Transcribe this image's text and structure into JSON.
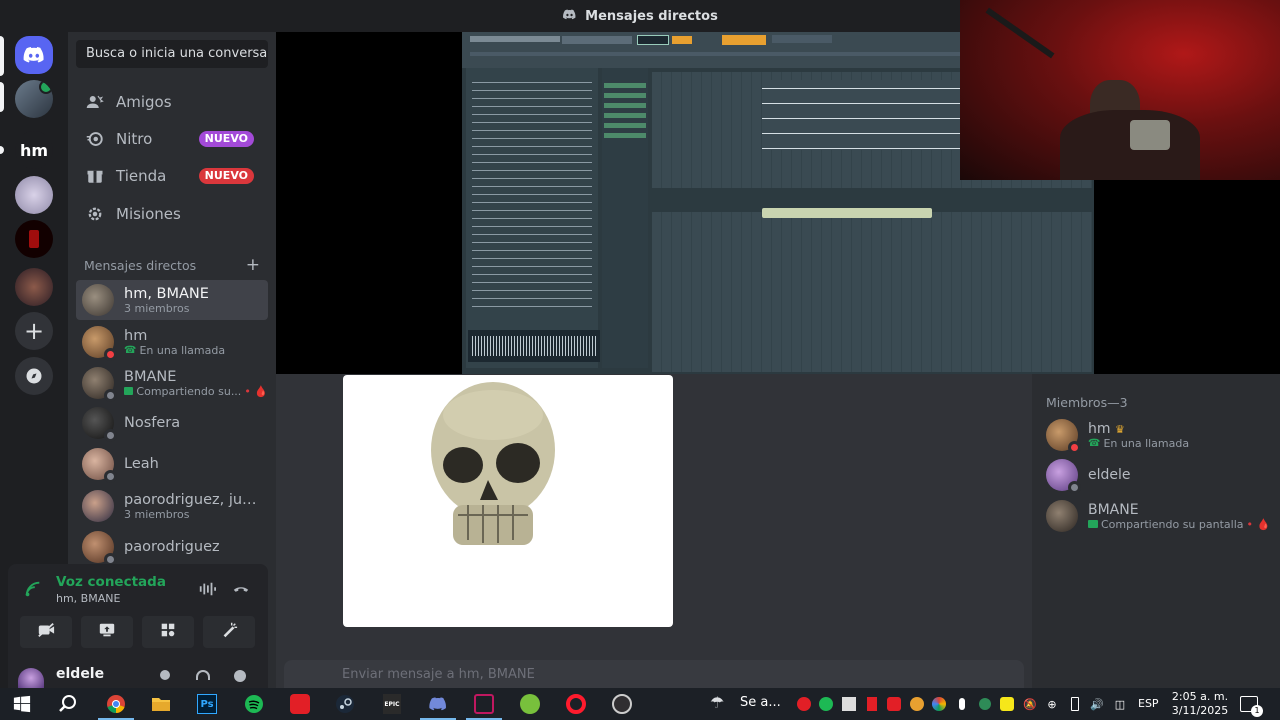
{
  "window": {
    "title": "Mensajes directos"
  },
  "servers": [
    {
      "label": "Discord"
    },
    {
      "label": "hm"
    }
  ],
  "sidebar": {
    "search_placeholder": "Busca o inicia una conversa...",
    "nav": [
      {
        "label": "Amigos",
        "icon": "friends-icon"
      },
      {
        "label": "Nitro",
        "icon": "nitro-icon",
        "badge": "NUEVO"
      },
      {
        "label": "Tienda",
        "icon": "shop-icon",
        "badge": "NUEVO"
      },
      {
        "label": "Misiones",
        "icon": "quests-icon"
      }
    ],
    "dm_header": "Mensajes directos",
    "dms": [
      {
        "name": "hm, BMANE",
        "sub": "3 miembros"
      },
      {
        "name": "hm",
        "sub": "En una llamada"
      },
      {
        "name": "BMANE",
        "sub": "Compartiendo su..."
      },
      {
        "name": "Nosfera",
        "sub": ""
      },
      {
        "name": "Leah",
        "sub": ""
      },
      {
        "name": "paorodriguez, just...",
        "sub": "3 miembros"
      },
      {
        "name": "paorodriguez",
        "sub": ""
      }
    ]
  },
  "voice": {
    "status": "Voz conectada",
    "channel": "hm, BMANE"
  },
  "user": {
    "name": "eldele"
  },
  "composer": {
    "placeholder": "Enviar mensaje a hm, BMANE"
  },
  "members": {
    "header": "Miembros—3",
    "list": [
      {
        "name": "hm",
        "sub": "En una llamada"
      },
      {
        "name": "eldele",
        "sub": ""
      },
      {
        "name": "BMANE",
        "sub": "Compartiendo su pantalla"
      }
    ]
  },
  "taskbar": {
    "weather": "Se a...",
    "lang": "ESP",
    "time": "2:05 a. m.",
    "date": "3/11/2025",
    "notif_count": "1"
  },
  "colors": {
    "accent": "#5865f2",
    "online": "#23a55a",
    "dnd": "#f23f43",
    "nuevo_nitro": "#a34ad8",
    "nuevo_shop": "#da373c"
  }
}
